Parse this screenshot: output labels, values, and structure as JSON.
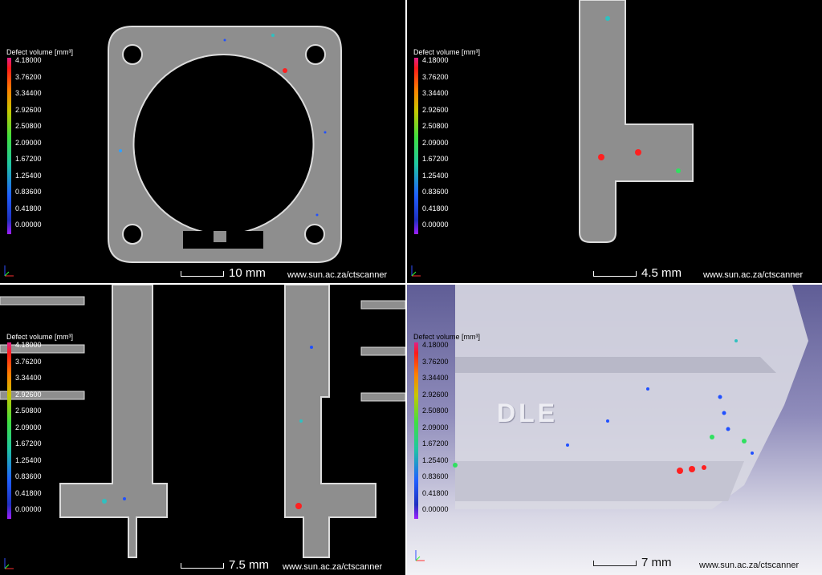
{
  "legend": {
    "title": "Defect volume [mm³]",
    "values": [
      "4.18000",
      "3.76200",
      "3.34400",
      "2.92600",
      "2.50800",
      "2.09000",
      "1.67200",
      "1.25400",
      "0.83600",
      "0.41800",
      "0.00000"
    ]
  },
  "viewports": [
    {
      "scale_label": "10 mm",
      "url": "www.sun.ac.za/ctscanner"
    },
    {
      "scale_label": "4.5 mm",
      "url": "www.sun.ac.za/ctscanner"
    },
    {
      "scale_label": "7.5 mm",
      "url": "www.sun.ac.za/ctscanner"
    },
    {
      "scale_label": "7 mm",
      "url": "www.sun.ac.za/ctscanner",
      "embossed_text": "DLE"
    }
  ],
  "colors": {
    "part_gray": "#8c8c8c",
    "defect_red": "#ff2020",
    "defect_blue": "#2050ff",
    "defect_green": "#30e060",
    "defect_cyan": "#30c0c0"
  }
}
